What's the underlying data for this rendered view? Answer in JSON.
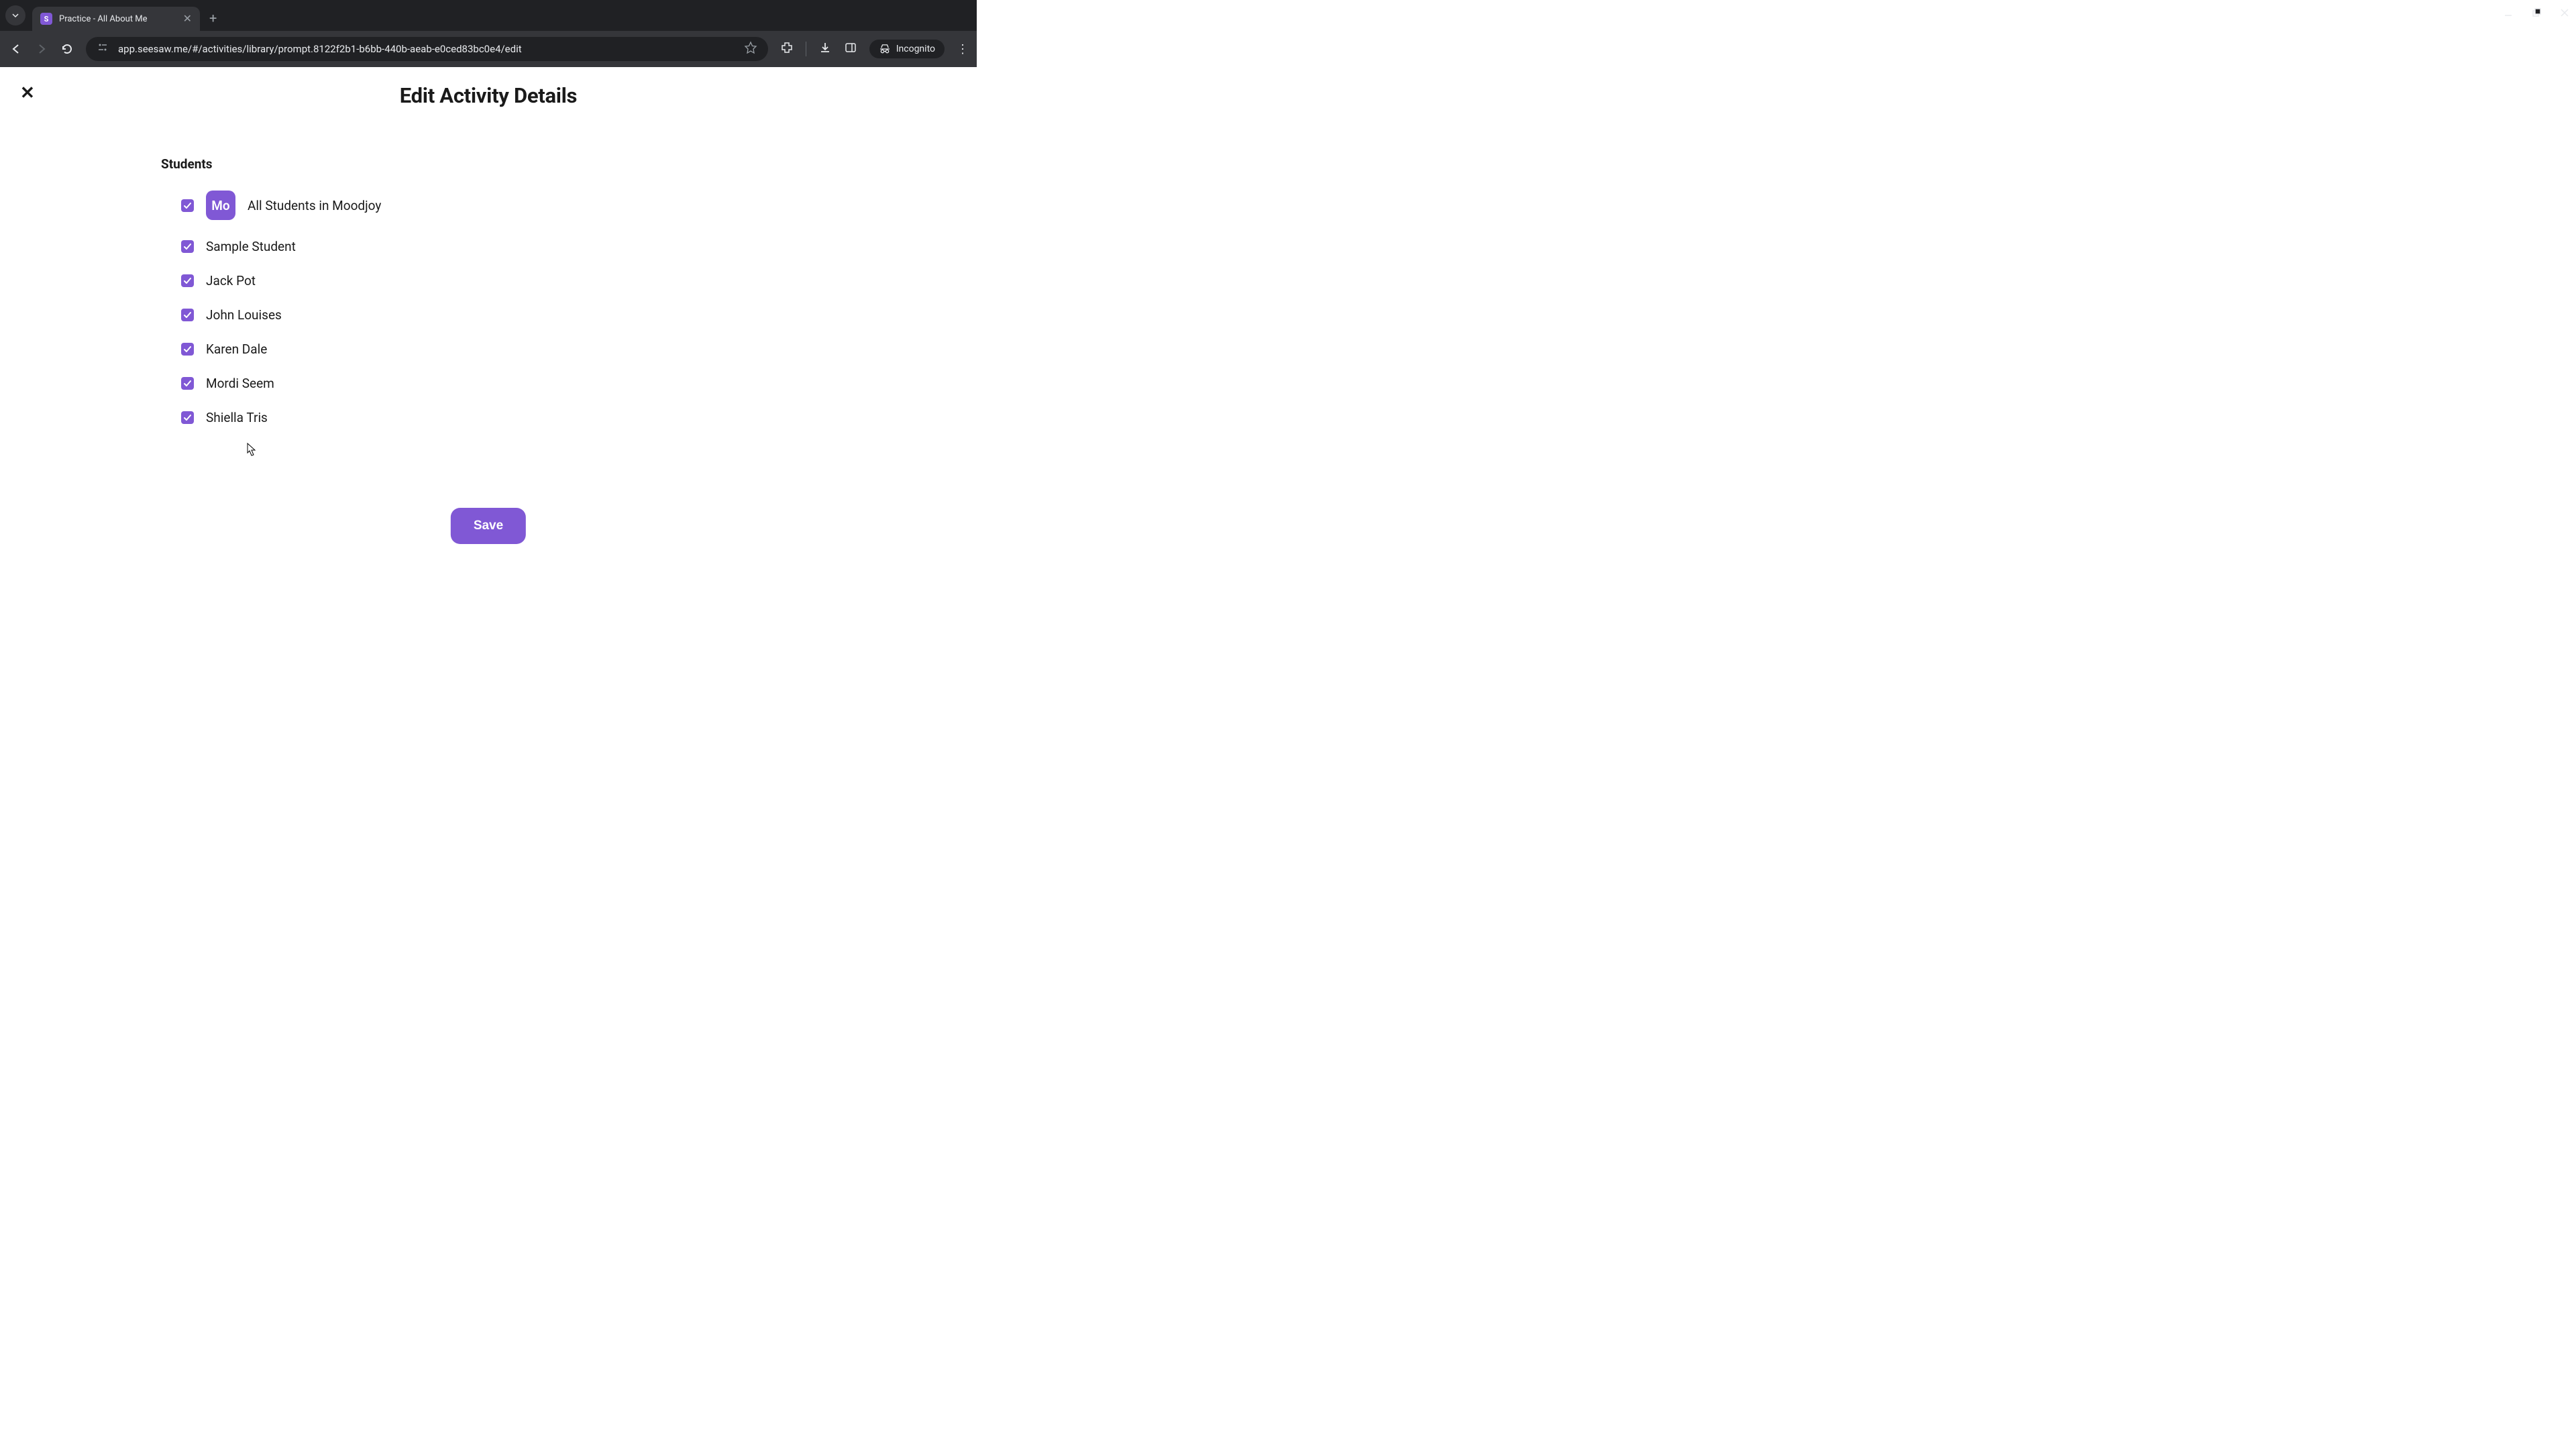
{
  "browser": {
    "tab_title": "Practice - All About Me",
    "tab_favicon_letter": "S",
    "url": "app.seesaw.me/#/activities/library/prompt.8122f2b1-b6bb-440b-aeab-e0ced83bc0e4/edit",
    "incognito_label": "Incognito"
  },
  "page": {
    "title": "Edit Activity Details",
    "section_label": "Students",
    "class_badge": "Mo",
    "all_students_label": "All Students in Moodjoy",
    "students": [
      "Sample Student",
      "Jack Pot",
      "John Louises",
      "Karen Dale",
      "Mordi Seem",
      "Shiella Tris"
    ],
    "save_button": "Save"
  }
}
